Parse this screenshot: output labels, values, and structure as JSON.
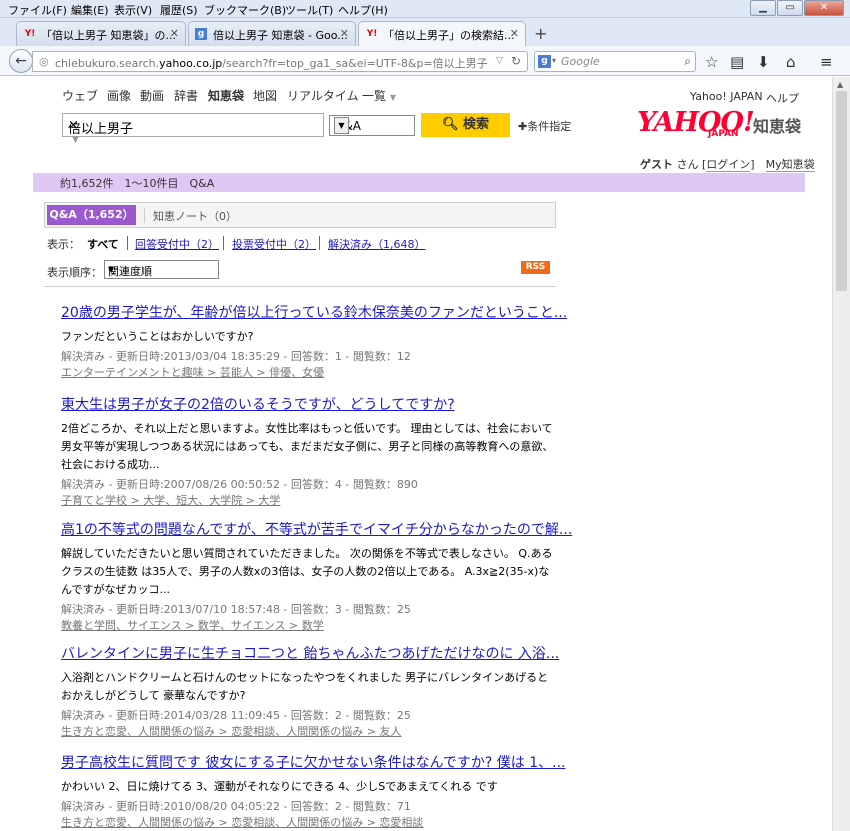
{
  "menubar": {
    "items": [
      "ファイル(F)",
      "編集(E)",
      "表示(V)",
      "履歴(S)",
      "ブックマーク(B)",
      "ツール(T)",
      "ヘルプ(H)"
    ]
  },
  "tabs": [
    {
      "label": "「倍以上男子 知恵袋」の...",
      "icon": "Y!"
    },
    {
      "label": "倍以上男子 知恵袋 - Goo...",
      "icon": "g"
    },
    {
      "label": "「倍以上男子」の検索結...",
      "icon": "Y!"
    }
  ],
  "url": {
    "prefix": "chiebukuro.search.",
    "domain": "yahoo.co.jp",
    "path": "/search?fr=top_ga1_sa&ei=UTF-8&p=倍以上男子"
  },
  "google_search": {
    "placeholder": "Google"
  },
  "global_nav": [
    "ウェブ",
    "画像",
    "動画",
    "辞書",
    "知恵袋",
    "地図",
    "リアルタイム",
    "一覧"
  ],
  "search": {
    "query": "倍以上男子",
    "type_selected": "Q&A",
    "button": "検索",
    "conditions": "条件指定"
  },
  "header_links": {
    "yahoo_japan": "Yahoo! JAPAN",
    "help": "ヘルプ"
  },
  "logo": {
    "main": "YAHOO!",
    "sub": "JAPAN",
    "service": "知恵袋"
  },
  "user": {
    "guest": "ゲスト",
    "san": "さん",
    "login": "ログイン",
    "my": "My知恵袋"
  },
  "count_bar": "約1,652件　1～10件目　Q&A",
  "result_tabs": {
    "qa": "Q&A（1,652）",
    "note": "知恵ノート（0）"
  },
  "filter": {
    "label": "表示：",
    "all": "すべて",
    "answering": "回答受付中（2）",
    "voting": "投票受付中（2）",
    "solved": "解決済み（1,648）"
  },
  "sort": {
    "label": "表示順序：",
    "selected": "関連度順"
  },
  "rss": "RSS",
  "results": [
    {
      "title": "20歳の男子学生が、年齢が倍以上行っている鈴木保奈美のファンだということ...",
      "desc": "ファンだということはおかしいですか?",
      "meta": "解決済み - 更新日時:2013/03/04 18:35:29 - 回答数：1 - 閲覧数：12",
      "category": "エンターテインメントと趣味 > 芸能人 > 俳優、女優"
    },
    {
      "title": "東大生は男子が女子の2倍のいるそうですが、どうしてですか?",
      "desc": "2倍どころか、それ以上だと思いますよ。女性比率はもっと低いです。 理由としては、社会において男女平等が実現しつつある状況にはあっても、まだまだ女子側に、男子と同様の高等教育への意欲、社会における成功...",
      "meta": "解決済み - 更新日時:2007/08/26 00:50:52 - 回答数：4 - 閲覧数：890",
      "category": "子育てと学校 > 大学、短大、大学院 > 大学"
    },
    {
      "title": "高1の不等式の問題なんですが、不等式が苦手でイマイチ分からなかったので解...",
      "desc": "解説していただきたいと思い質問されていただきました。 次の関係を不等式で表しなさい。 Q.あるクラスの生徒数 は35人で、男子の人数xの3倍は、女子の人数の2倍以上である。 A.3x≧2(35-x)なんですがなぜカッコ...",
      "meta": "解決済み - 更新日時:2013/07/10 18:57:48 - 回答数：3 - 閲覧数：25",
      "category": "教養と学問、サイエンス > 数学、サイエンス > 数学"
    },
    {
      "title": "バレンタインに男子に生チョコ二つと 飴ちゃんふたつあげただけなのに 入浴...",
      "desc": "入浴剤とハンドクリームと石けんのセットになったやつをくれました 男子にバレンタインあげると おかえしがどうして 豪華なんですか?",
      "meta": "解決済み - 更新日時:2014/03/28 11:09:45 - 回答数：2 - 閲覧数：25",
      "category": "生き方と恋愛、人間関係の悩み > 恋愛相談、人間関係の悩み > 友人"
    },
    {
      "title": "男子高校生に質問です 彼女にする子に欠かせない条件はなんですか? 僕は 1、...",
      "desc": "かわいい 2、日に焼けてる 3、運動がそれなりにできる 4、少しSであまえてくれる です",
      "meta": "解決済み - 更新日時:2010/08/20 04:05:22 - 回答数：2 - 閲覧数：71",
      "category": "生き方と恋愛、人間関係の悩み > 恋愛相談、人間関係の悩み > 恋愛相談"
    }
  ]
}
